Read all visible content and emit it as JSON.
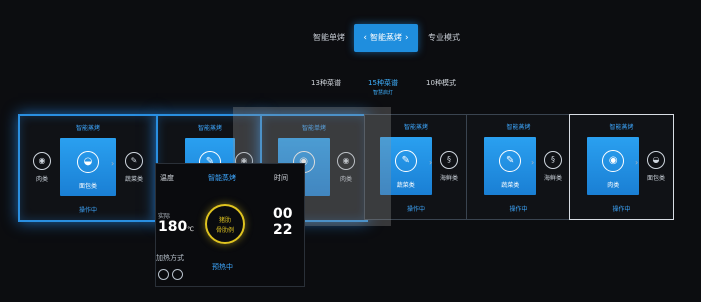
{
  "mode_tabs": [
    {
      "label": "智能单烤",
      "active": false
    },
    {
      "label": "智能蒸烤",
      "active": true
    },
    {
      "label": "专业模式",
      "active": false
    }
  ],
  "sub_tabs": [
    {
      "label": "13种菜谱",
      "active": false,
      "hint": ""
    },
    {
      "label": "15种菜谱",
      "active": true,
      "hint": "智慧启灯"
    },
    {
      "label": "10种模式",
      "active": false,
      "hint": ""
    }
  ],
  "cards": [
    {
      "title": "智能蒸烤",
      "left_label": "肉类",
      "left_icon": "fish-icon",
      "center_label": "面包类",
      "center_icon": "bread-icon",
      "right_label": "蔬菜类",
      "right_icon": "vegetable-icon",
      "status": "操作中"
    },
    {
      "title": "智能蒸烤",
      "left_label": "",
      "left_icon": "",
      "center_label": "",
      "center_icon": "vegetable-icon",
      "right_label": "",
      "right_icon": "fish-icon",
      "status": ""
    },
    {
      "title": "智能单烤",
      "left_label": "",
      "left_icon": "",
      "center_label": "",
      "center_icon": "fish-icon",
      "right_label": "肉类",
      "right_icon": "fish-icon",
      "status": ""
    },
    {
      "title": "智能蒸烤",
      "left_label": "",
      "left_icon": "",
      "center_label": "蔬菜类",
      "center_icon": "vegetable-icon",
      "right_label": "海鲜类",
      "right_icon": "shrimp-icon",
      "status": "操作中"
    },
    {
      "title": "智能蒸烤",
      "left_label": "",
      "left_icon": "",
      "center_label": "蔬菜类",
      "center_icon": "vegetable-icon",
      "right_label": "海鲜类",
      "right_icon": "shrimp-icon",
      "status": "操作中"
    },
    {
      "title": "智能蒸烤",
      "left_label": "",
      "left_icon": "",
      "center_label": "肉类",
      "center_icon": "fish-icon",
      "right_label": "面包类",
      "right_icon": "bread-icon",
      "status": "操作中"
    }
  ],
  "detail": {
    "temp_header": "温度",
    "mode_header": "智能蒸烤",
    "time_header": "时间",
    "actual_label": "实际",
    "temp_value": "180",
    "temp_unit": "℃",
    "ring_line1": "猪肋",
    "ring_line2": "骨肋例",
    "time_value_1": "00",
    "time_value_2": "22",
    "method_label": "加热方式",
    "status": "预热中"
  },
  "colors": {
    "accent": "#2a8fe0",
    "ring": "#e0c420"
  }
}
